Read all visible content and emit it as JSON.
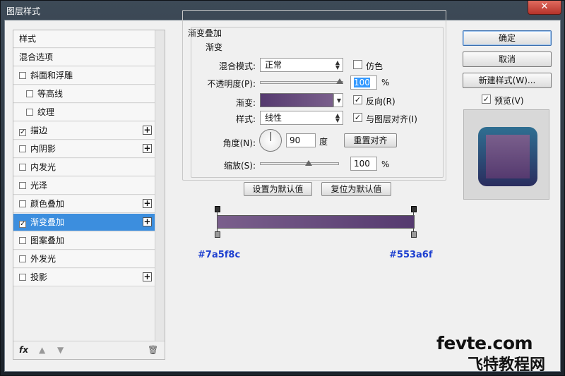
{
  "window": {
    "title": "图层样式",
    "close": "✕"
  },
  "colors": {
    "gradient_start": "#7a5f8c",
    "gradient_end": "#553a6f",
    "selection": "#3c8ede"
  },
  "sidebar": {
    "items": [
      {
        "label": "样式",
        "checkbox": false,
        "checked": false,
        "plus": false,
        "sub": false,
        "selected": false
      },
      {
        "label": "混合选项",
        "checkbox": false,
        "checked": false,
        "plus": false,
        "sub": false,
        "selected": false
      },
      {
        "label": "斜面和浮雕",
        "checkbox": true,
        "checked": false,
        "plus": false,
        "sub": false,
        "selected": false
      },
      {
        "label": "等高线",
        "checkbox": true,
        "checked": false,
        "plus": false,
        "sub": true,
        "selected": false
      },
      {
        "label": "纹理",
        "checkbox": true,
        "checked": false,
        "plus": false,
        "sub": true,
        "selected": false
      },
      {
        "label": "描边",
        "checkbox": true,
        "checked": true,
        "plus": true,
        "sub": false,
        "selected": false
      },
      {
        "label": "内阴影",
        "checkbox": true,
        "checked": false,
        "plus": true,
        "sub": false,
        "selected": false
      },
      {
        "label": "内发光",
        "checkbox": true,
        "checked": false,
        "plus": false,
        "sub": false,
        "selected": false
      },
      {
        "label": "光泽",
        "checkbox": true,
        "checked": false,
        "plus": false,
        "sub": false,
        "selected": false
      },
      {
        "label": "颜色叠加",
        "checkbox": true,
        "checked": false,
        "plus": true,
        "sub": false,
        "selected": false
      },
      {
        "label": "渐变叠加",
        "checkbox": true,
        "checked": true,
        "plus": true,
        "sub": false,
        "selected": true
      },
      {
        "label": "图案叠加",
        "checkbox": true,
        "checked": false,
        "plus": false,
        "sub": false,
        "selected": false
      },
      {
        "label": "外发光",
        "checkbox": true,
        "checked": false,
        "plus": false,
        "sub": false,
        "selected": false
      },
      {
        "label": "投影",
        "checkbox": true,
        "checked": false,
        "plus": true,
        "sub": false,
        "selected": false
      }
    ],
    "footer": {
      "fx": "fx",
      "up": "▲",
      "down": "▼",
      "trash": "🗑"
    }
  },
  "panel": {
    "group_title": "渐变叠加",
    "subgroup_title": "渐变",
    "blend_mode_label": "混合模式:",
    "blend_mode_value": "正常",
    "dither_label": "仿色",
    "dither_checked": false,
    "opacity_label": "不透明度(P):",
    "opacity_value": "100",
    "opacity_unit": "%",
    "gradient_label": "渐变:",
    "reverse_label": "反向(R)",
    "reverse_checked": true,
    "style_label": "样式:",
    "style_value": "线性",
    "align_label": "与图层对齐(I)",
    "align_checked": true,
    "angle_label": "角度(N):",
    "angle_value": "90",
    "angle_unit": "度",
    "reset_align_button": "重置对齐",
    "scale_label": "缩放(S):",
    "scale_value": "100",
    "scale_unit": "%",
    "make_default_button": "设置为默认值",
    "reset_default_button": "复位为默认值"
  },
  "gradient_editor": {
    "left_hex": "#7a5f8c",
    "right_hex": "#553a6f"
  },
  "actions": {
    "ok": "确定",
    "cancel": "取消",
    "new_style": "新建样式(W)...",
    "preview_label": "预览(V)",
    "preview_checked": true
  },
  "watermark": {
    "line1": "fevte.com",
    "line2": "飞特教程网"
  }
}
